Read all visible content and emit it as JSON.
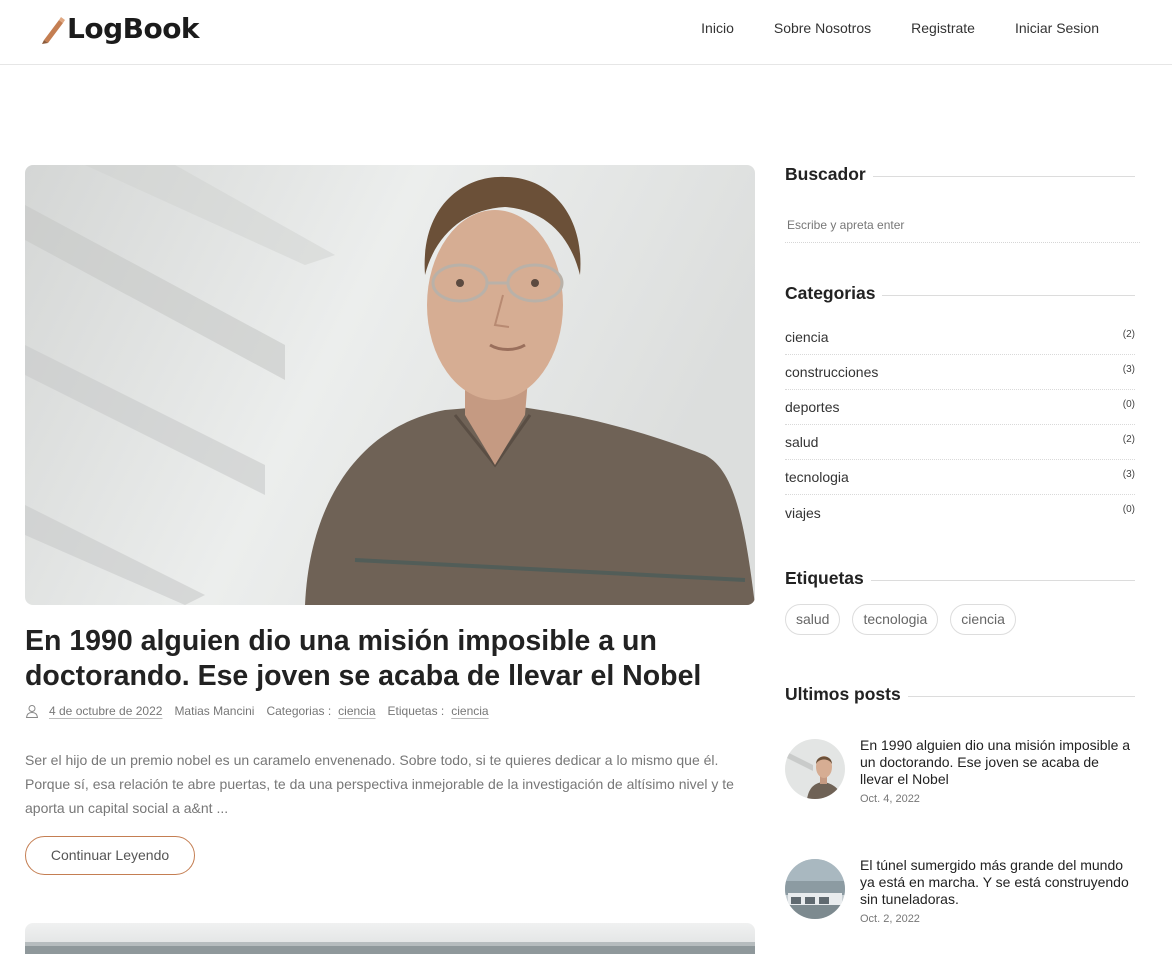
{
  "header": {
    "logo_text": "LogBook",
    "nav": [
      "Inicio",
      "Sobre Nosotros",
      "Registrate",
      "Iniciar Sesion"
    ]
  },
  "post": {
    "title": "En 1990 alguien dio una misión imposible a un doctorando. Ese joven se acaba de llevar el Nobel",
    "date": "4 de octubre de 2022",
    "author": "Matias Mancini",
    "categories_label": "Categorias :",
    "category": "ciencia",
    "tags_label": "Etiquetas :",
    "tag": "ciencia",
    "excerpt": "Ser el hijo de un premio nobel es un caramelo envenenado. Sobre todo, si te quieres dedicar a lo mismo que él. Porque sí, esa relación te abre puertas, te da una perspectiva inmejorable de la investigación de altísimo nivel y te aporta un capital social a a&nt ...",
    "read_more": "Continuar Leyendo"
  },
  "sidebar": {
    "search": {
      "title": "Buscador",
      "placeholder": "Escribe y apreta enter"
    },
    "categories": {
      "title": "Categorias",
      "items": [
        {
          "name": "ciencia",
          "count": "(2)"
        },
        {
          "name": "construcciones",
          "count": "(3)"
        },
        {
          "name": "deportes",
          "count": "(0)"
        },
        {
          "name": "salud",
          "count": "(2)"
        },
        {
          "name": "tecnologia",
          "count": "(3)"
        },
        {
          "name": "viajes",
          "count": "(0)"
        }
      ]
    },
    "tags": {
      "title": "Etiquetas",
      "items": [
        "salud",
        "tecnologia",
        "ciencia"
      ]
    },
    "recent": {
      "title": "Ultimos posts",
      "items": [
        {
          "title": "En 1990 alguien dio una misión imposible a un doctorando. Ese joven se acaba de llevar el Nobel",
          "date": "Oct. 4, 2022"
        },
        {
          "title": "El túnel sumergido más grande del mundo ya está en marcha. Y se está construyendo sin tuneladoras.",
          "date": "Oct. 2, 2022"
        }
      ]
    }
  },
  "colors": {
    "accent": "#c47e52",
    "text": "#222222",
    "muted": "#777777",
    "border": "#dddddd"
  }
}
